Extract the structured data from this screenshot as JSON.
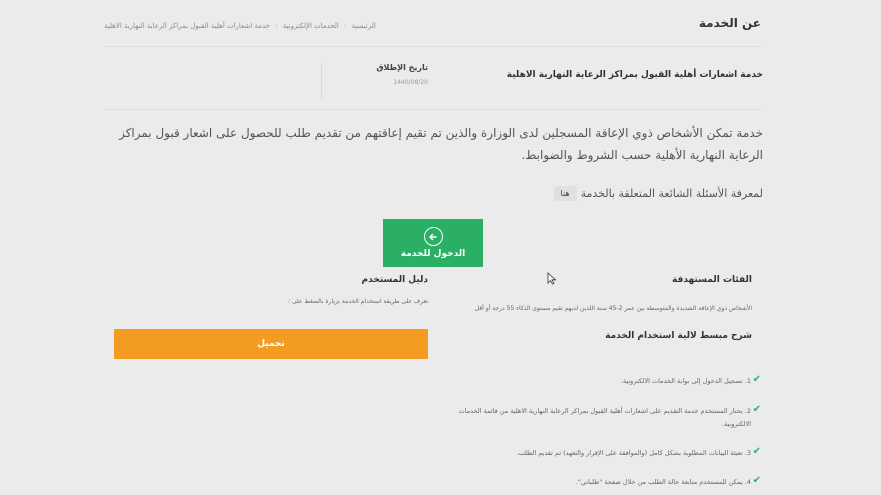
{
  "header": {
    "title": "عن الخدمة",
    "breadcrumb": [
      "الرئيسية",
      "الخدمات الإلكترونية",
      "خدمة اشعارات أهلية القبول بمراكز الرعاية النهارية الاهلية"
    ]
  },
  "service": {
    "name": "خدمة اشعارات أهلية القبول بمراكز الرعاية النهارية الاهلية",
    "launch_label": "تاريخ الإطلاق",
    "launch_date": "1440/08/20",
    "description": "خدمة تمكن الأشخاص ذوي الإعاقة المسجلين لدى الوزارة والذين تم تقيم إعاقتهم من تقديم طلب للحصول على اشعار قبول بمراكز الرعاية النهارية الأهلية حسب الشروط والضوابط.",
    "faq_text": "لمعرفة الأسئلة الشائعة المتعلقة بالخدمة",
    "faq_link": "هنا",
    "enter_label": "الدخول للخدمة"
  },
  "target": {
    "title": "الفئات المستهدفة",
    "text": "الأشخاص ذوي الإعاقة الشديدة والمتوسطة بين عمر 2-45 سنة اللذين لديهم تقيم مستوى الذكاء 55 درجة أو أقل"
  },
  "guide": {
    "title": "دليل المستخدم",
    "text": "تعرف على طريقة استخدام الخدمة بزيارة بالضغط على :",
    "download_label": "تحميل"
  },
  "usage": {
    "title": "شرح مبسط لالية استخدام الخدمة",
    "steps": [
      "1. تسجيل الدخول إلى بوابة الخدمات الالكترونية.",
      "2. يختار المستخدم خدمة التقديم على اشعارات أهلية القبول بمراكز الرعاية النهارية الاهلية من قائمة الخدمات الالكترونية.",
      "3. تعبئة البيانات المطلوبة بشكل كامل (والموافقة على الإقرار والتعهد) ثم تقديم الطلب.",
      "4. يمكن للمستخدم متابعة حالة الطلب من خلال صفحة \"طلباتي\"."
    ]
  },
  "colors": {
    "primary": "#2aaf65",
    "accent": "#f49b22",
    "background": "#ebebeb"
  }
}
